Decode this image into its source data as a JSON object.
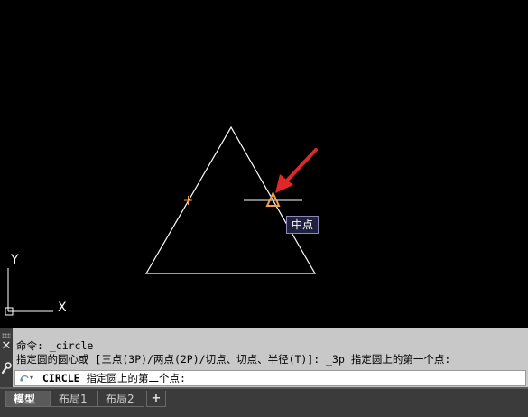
{
  "viewport": {
    "tooltip": "中点",
    "ucs": {
      "x_label": "X",
      "y_label": "Y"
    }
  },
  "command_line": {
    "history": [
      "命令: _circle",
      "指定圆的圆心或 [三点(3P)/两点(2P)/切点、切点、半径(T)]: _3p 指定圆上的第一个点:"
    ],
    "input_command": "CIRCLE",
    "input_prompt": " 指定圆上的第二个点:"
  },
  "tabs": {
    "model": "模型",
    "layout1": "布局1",
    "layout2": "布局2",
    "add": "+"
  },
  "colors": {
    "background": "#000000",
    "drawing_line": "#ffffff",
    "snap_marker": "#f0a050",
    "arrow": "#e02828"
  },
  "icons": {
    "close": "close-icon",
    "wrench": "wrench-icon",
    "prompt": "command-prompt-icon"
  }
}
